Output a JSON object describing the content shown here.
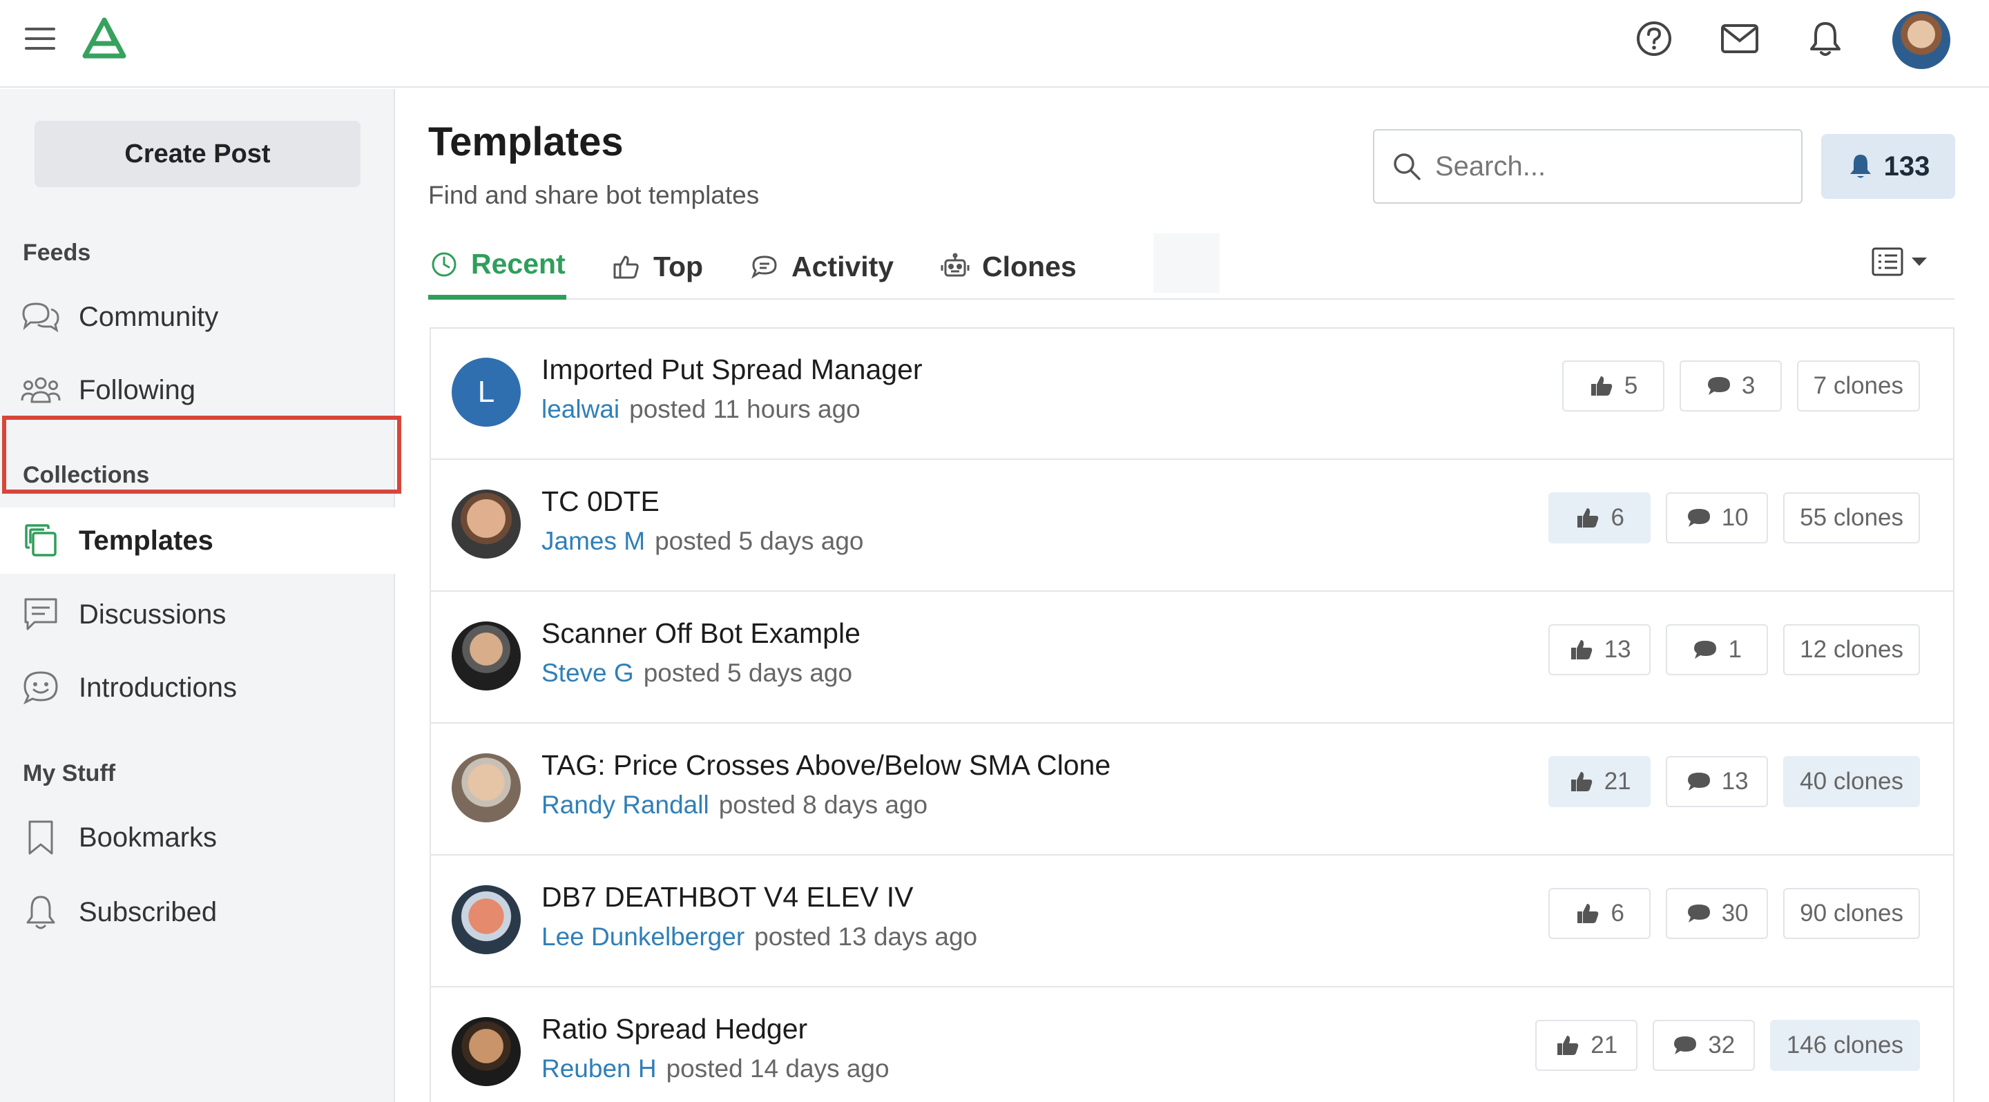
{
  "header": {
    "icons": [
      "menu-icon",
      "logo-icon",
      "help-icon",
      "mail-icon",
      "bell-icon",
      "user-avatar"
    ]
  },
  "sidebar": {
    "create_post_label": "Create Post",
    "sections": [
      {
        "title": "Feeds",
        "items": [
          {
            "label": "Community",
            "icon": "chat-bubbles-icon"
          },
          {
            "label": "Following",
            "icon": "people-icon"
          }
        ]
      },
      {
        "title": "Collections",
        "items": [
          {
            "label": "Templates",
            "icon": "copy-icon",
            "active": true
          },
          {
            "label": "Discussions",
            "icon": "message-square-icon"
          },
          {
            "label": "Introductions",
            "icon": "smile-bubble-icon"
          }
        ]
      },
      {
        "title": "My Stuff",
        "items": [
          {
            "label": "Bookmarks",
            "icon": "bookmark-icon"
          },
          {
            "label": "Subscribed",
            "icon": "bell-icon"
          }
        ]
      }
    ]
  },
  "main": {
    "title": "Templates",
    "subtitle": "Find and share bot templates",
    "search": {
      "placeholder": "Search...",
      "value": ""
    },
    "notification_count": "133",
    "tabs": [
      {
        "label": "Recent",
        "icon": "clock-icon",
        "active": true
      },
      {
        "label": "Top",
        "icon": "thumbs-up-icon"
      },
      {
        "label": "Activity",
        "icon": "comment-icon"
      },
      {
        "label": "Clones",
        "icon": "robot-icon"
      }
    ],
    "view_toggle_icon": "list-view-icon",
    "posts": [
      {
        "title": "Imported Put Spread Manager",
        "author": "lealwai",
        "posted": "posted 11 hours ago",
        "likes": "5",
        "comments": "3",
        "clones": "7 clones",
        "avatar_letter": "L",
        "liked": false,
        "cloned": false
      },
      {
        "title": "TC 0DTE",
        "author": "James M",
        "posted": "posted 5 days ago",
        "likes": "6",
        "comments": "10",
        "clones": "55 clones",
        "avatar_letter": "",
        "liked": true,
        "cloned": false
      },
      {
        "title": "Scanner Off Bot Example",
        "author": "Steve G",
        "posted": "posted 5 days ago",
        "likes": "13",
        "comments": "1",
        "clones": "12 clones",
        "avatar_letter": "",
        "liked": false,
        "cloned": false
      },
      {
        "title": "TAG: Price Crosses Above/Below SMA Clone",
        "author": "Randy Randall",
        "posted": "posted 8 days ago",
        "likes": "21",
        "comments": "13",
        "clones": "40 clones",
        "avatar_letter": "",
        "liked": true,
        "cloned": true
      },
      {
        "title": "DB7 DEATHBOT V4 ELEV IV",
        "author": "Lee Dunkelberger",
        "posted": "posted 13 days ago",
        "likes": "6",
        "comments": "30",
        "clones": "90 clones",
        "avatar_letter": "",
        "liked": false,
        "cloned": false
      },
      {
        "title": "Ratio Spread Hedger",
        "author": "Reuben H",
        "posted": "posted 14 days ago",
        "likes": "21",
        "comments": "32",
        "clones": "146 clones",
        "avatar_letter": "",
        "liked": false,
        "cloned": true
      }
    ]
  },
  "colors": {
    "accent_green": "#2f9e5b",
    "link_blue": "#2f7fb8",
    "highlight_red": "#d9453a",
    "avatar_blue": "#2f6fb0"
  }
}
